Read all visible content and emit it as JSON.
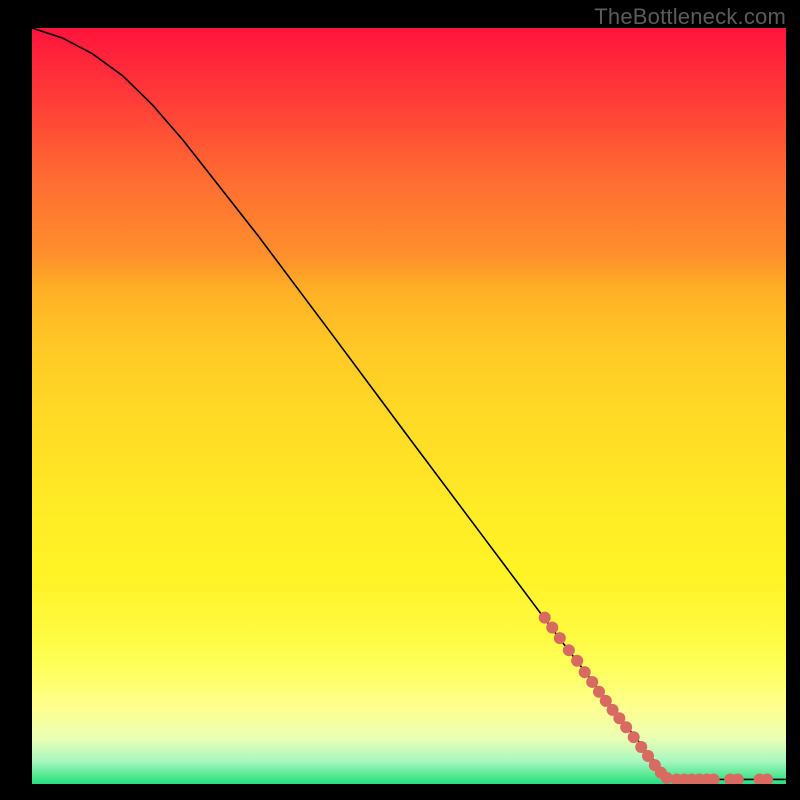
{
  "watermark": "TheBottleneck.com",
  "colors": {
    "marker": "#d86a62",
    "curve": "#000000",
    "background_top": "#ff143c",
    "background_bottom": "#28de82",
    "frame": "#000000"
  },
  "chart_data": {
    "type": "line",
    "title": "",
    "xlabel": "",
    "ylabel": "",
    "xlim": [
      0,
      100
    ],
    "ylim": [
      0,
      100
    ],
    "grid": false,
    "curve_points": [
      {
        "x": 0.0,
        "y": 100.0
      },
      {
        "x": 4.0,
        "y": 98.7
      },
      {
        "x": 8.0,
        "y": 96.6
      },
      {
        "x": 12.0,
        "y": 93.7
      },
      {
        "x": 16.0,
        "y": 89.8
      },
      {
        "x": 20.0,
        "y": 85.2
      },
      {
        "x": 30.0,
        "y": 72.5
      },
      {
        "x": 40.0,
        "y": 59.2
      },
      {
        "x": 50.0,
        "y": 45.8
      },
      {
        "x": 60.0,
        "y": 32.5
      },
      {
        "x": 70.0,
        "y": 19.2
      },
      {
        "x": 80.0,
        "y": 6.2
      },
      {
        "x": 84.5,
        "y": 0.6
      },
      {
        "x": 100.0,
        "y": 0.6
      }
    ],
    "markers": [
      {
        "x": 68.0,
        "y": 22.0
      },
      {
        "x": 69.0,
        "y": 20.7
      },
      {
        "x": 70.0,
        "y": 19.3
      },
      {
        "x": 71.2,
        "y": 17.7
      },
      {
        "x": 72.3,
        "y": 16.3
      },
      {
        "x": 73.3,
        "y": 14.8
      },
      {
        "x": 74.3,
        "y": 13.5
      },
      {
        "x": 75.2,
        "y": 12.2
      },
      {
        "x": 76.1,
        "y": 11.0
      },
      {
        "x": 77.0,
        "y": 9.8
      },
      {
        "x": 77.9,
        "y": 8.7
      },
      {
        "x": 78.8,
        "y": 7.5
      },
      {
        "x": 79.8,
        "y": 6.2
      },
      {
        "x": 80.8,
        "y": 4.9
      },
      {
        "x": 81.7,
        "y": 3.7
      },
      {
        "x": 82.6,
        "y": 2.5
      },
      {
        "x": 83.4,
        "y": 1.5
      },
      {
        "x": 84.2,
        "y": 0.8
      },
      {
        "x": 85.5,
        "y": 0.6
      },
      {
        "x": 86.5,
        "y": 0.6
      },
      {
        "x": 87.5,
        "y": 0.6
      },
      {
        "x": 88.5,
        "y": 0.6
      },
      {
        "x": 89.5,
        "y": 0.6
      },
      {
        "x": 90.4,
        "y": 0.6
      },
      {
        "x": 92.6,
        "y": 0.6
      },
      {
        "x": 93.6,
        "y": 0.6
      },
      {
        "x": 96.5,
        "y": 0.6
      },
      {
        "x": 97.5,
        "y": 0.6
      }
    ]
  }
}
